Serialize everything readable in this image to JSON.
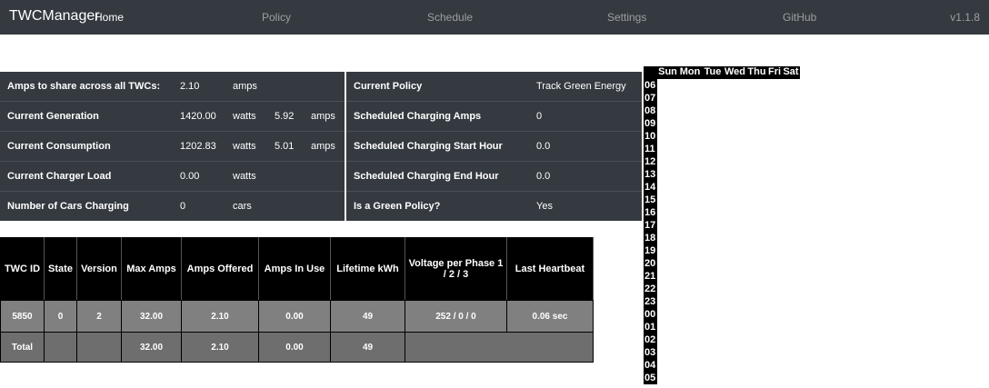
{
  "nav": {
    "brand": "TWCManager",
    "links": [
      "Home",
      "Policy",
      "Schedule",
      "Settings",
      "GitHub"
    ],
    "version": "v1.1.8"
  },
  "left_table": [
    {
      "label": "Amps to share across all TWCs:",
      "v1": "2.10",
      "u1": "amps",
      "v2": "",
      "u2": ""
    },
    {
      "label": "Current Generation",
      "v1": "1420.00",
      "u1": "watts",
      "v2": "5.92",
      "u2": "amps"
    },
    {
      "label": "Current Consumption",
      "v1": "1202.83",
      "u1": "watts",
      "v2": "5.01",
      "u2": "amps"
    },
    {
      "label": "Current Charger Load",
      "v1": "0.00",
      "u1": "watts",
      "v2": "",
      "u2": ""
    },
    {
      "label": "Number of Cars Charging",
      "v1": "0",
      "u1": "cars",
      "v2": "",
      "u2": ""
    }
  ],
  "right_table": [
    {
      "label": "Current Policy",
      "value": "Track Green Energy"
    },
    {
      "label": "Scheduled Charging Amps",
      "value": "0"
    },
    {
      "label": "Scheduled Charging Start Hour",
      "value": "0.0"
    },
    {
      "label": "Scheduled Charging End Hour",
      "value": "0.0"
    },
    {
      "label": "Is a Green Policy?",
      "value": "Yes"
    }
  ],
  "twc_table": {
    "headers": [
      "TWC ID",
      "State",
      "Version",
      "Max Amps",
      "Amps Offered",
      "Amps In Use",
      "Lifetime kWh",
      "Voltage per Phase 1 / 2 / 3",
      "Last Heartbeat"
    ],
    "row": [
      "5850",
      "0",
      "2",
      "32.00",
      "2.10",
      "0.00",
      "49",
      "252 / 0 / 0",
      "0.06 sec"
    ],
    "total": {
      "label": "Total",
      "max_amps": "32.00",
      "amps_offered": "2.10",
      "amps_in_use": "0.00",
      "lifetime_kwh": "49"
    }
  },
  "schedule": {
    "days": [
      "Sun",
      "Mon",
      "Tue",
      "Wed",
      "Thu",
      "Fri",
      "Sat"
    ],
    "hours": [
      "06",
      "07",
      "08",
      "09",
      "10",
      "11",
      "12",
      "13",
      "14",
      "15",
      "16",
      "17",
      "18",
      "19",
      "20",
      "21",
      "22",
      "23",
      "00",
      "01",
      "02",
      "03",
      "04",
      "05"
    ]
  }
}
